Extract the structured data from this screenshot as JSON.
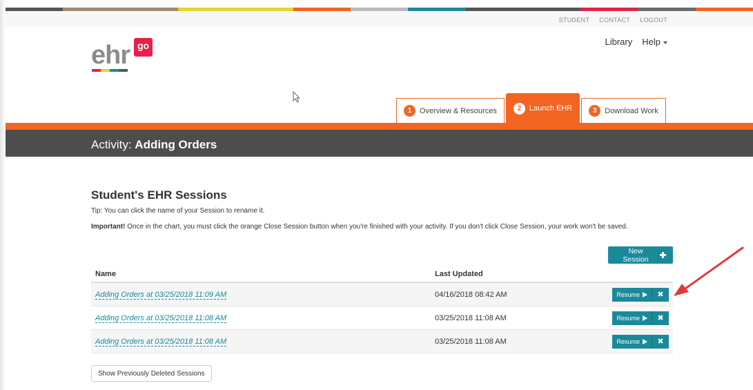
{
  "top_links": [
    "STUDENT",
    "CONTACT",
    "LOGOUT"
  ],
  "logo": {
    "text": "ehr",
    "badge": "go"
  },
  "top_nav": {
    "library": "Library",
    "help": "Help"
  },
  "tabs": [
    {
      "num": "1",
      "label": "Overview & Resources",
      "active": false
    },
    {
      "num": "2",
      "label": "Launch EHR",
      "active": true
    },
    {
      "num": "3",
      "label": "Download Work",
      "active": false
    }
  ],
  "activity": {
    "prefix": "Activity: ",
    "name": "Adding Orders"
  },
  "sessions": {
    "title": "Student's EHR Sessions",
    "tip": "Tip: You can click the name of your Session to rename it.",
    "important_label": "Important!",
    "important_text": " Once in the chart, you must click the orange Close Session button when you're finished with your activity. If you don't click Close Session, your work won't be saved.",
    "new_session_label": "New Session",
    "columns": {
      "name": "Name",
      "updated": "Last Updated"
    },
    "rows": [
      {
        "name": "Adding Orders at 03/25/2018 11:09 AM",
        "updated": "04/16/2018 08:42 AM"
      },
      {
        "name": "Adding Orders at 03/25/2018 11:08 AM",
        "updated": "03/25/2018 11:08 AM"
      },
      {
        "name": "Adding Orders at 03/25/2018 11:08 AM",
        "updated": "03/25/2018 11:08 AM"
      }
    ],
    "resume_label": "Resume",
    "deleted_label": "Show Previously Deleted Sessions"
  },
  "colors": {
    "accent_orange": "#f26522",
    "teal": "#1a8a9a",
    "header_dark": "#4d4d4d",
    "logo_red": "#e5204b",
    "annotation_arrow": "#e03a3a"
  },
  "icons": {
    "play": "play-icon",
    "close": "close-icon",
    "plus": "plus-icon",
    "caret": "caret-down-icon",
    "cursor": "mouse-pointer-icon",
    "arrow": "annotation-arrow-icon"
  }
}
